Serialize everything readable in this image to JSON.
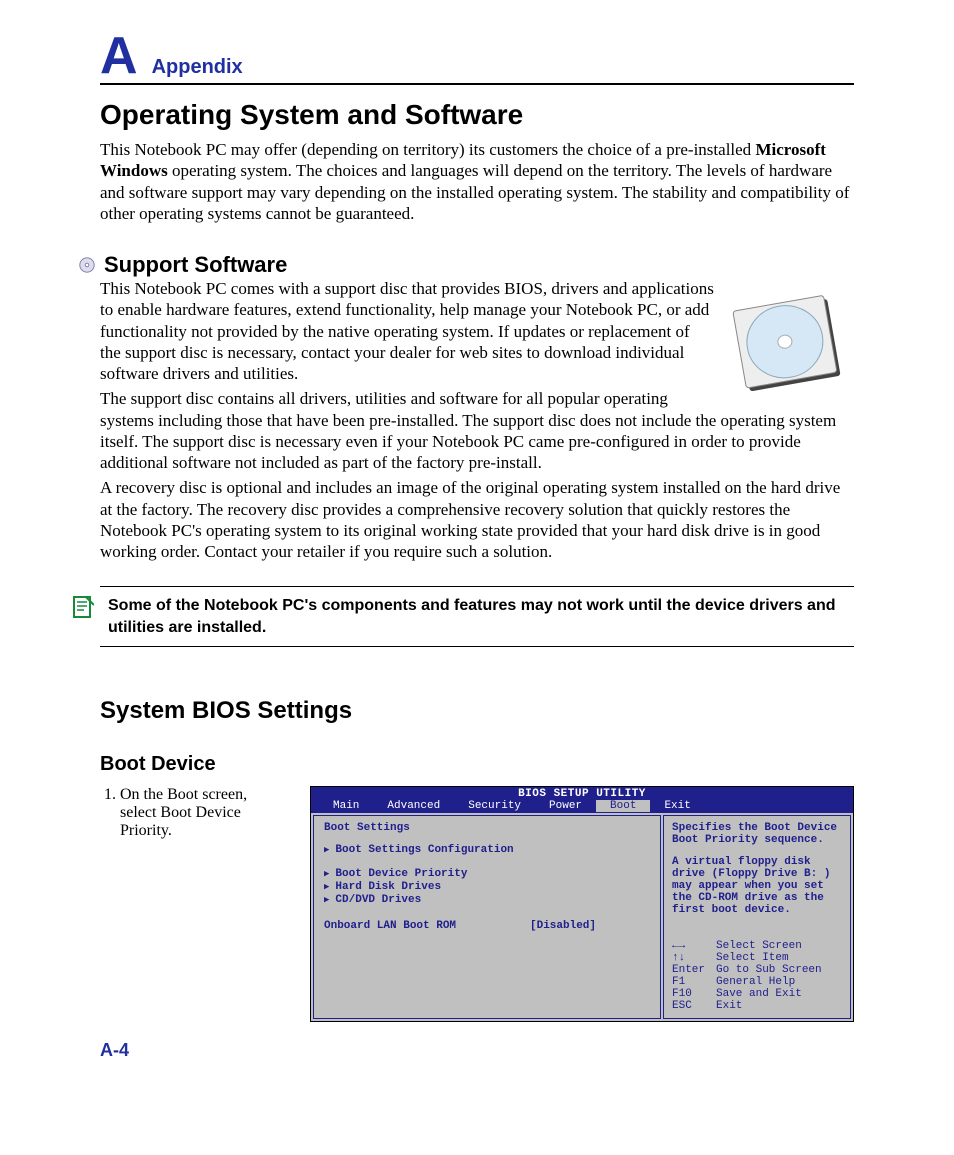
{
  "appendix": {
    "letter": "A",
    "word": "Appendix"
  },
  "title": "Operating System and Software",
  "intro_parts": {
    "p1": "This Notebook PC may offer (depending on territory) its customers the choice of a pre-installed ",
    "bold": "Microsoft Windows",
    "p2": " operating system. The choices and languages will depend on the territory. The levels of hardware and software support may vary depending on the installed operating system. The stability and compatibility of other operating systems cannot be guaranteed."
  },
  "support": {
    "heading": "Support Software",
    "p1": "This Notebook PC comes with a support disc that provides BIOS, drivers and applications to enable hardware features, extend functionality, help manage your Notebook PC, or add functionality not provided by the native operating system. If updates or replacement of the support disc is necessary, contact your dealer for web sites to download individual software drivers and utilities.",
    "p2": "The support disc contains all drivers, utilities and software for all popular operating systems including those that have been pre-installed. The support disc does not include the operating system itself. The support disc is necessary even if your Notebook PC came pre-configured in order to provide additional software not included as part of the factory pre-install.",
    "p3": "A recovery disc is optional and includes an image of the original operating system installed on the hard drive at the factory. The recovery disc provides a comprehensive recovery solution that quickly restores the Notebook PC's operating system to its original working state provided that your hard disk drive is in good working order. Contact your retailer if you require such a solution."
  },
  "note": "Some of the Notebook PC's components and features may not work until the device drivers and utilities are installed.",
  "bios_section": {
    "heading": "System BIOS Settings",
    "sub": "Boot Device",
    "instruction": "On the Boot screen, select Boot Device Priority."
  },
  "bios": {
    "title": "BIOS SETUP UTILITY",
    "tabs": [
      "Main",
      "Advanced",
      "Security",
      "Power",
      "Boot",
      "Exit"
    ],
    "active_tab": "Boot",
    "panel_title": "Boot Settings",
    "items": [
      "Boot Settings Configuration",
      "Boot Device Priority",
      "Hard Disk Drives",
      "CD/DVD Drives"
    ],
    "option": {
      "name": "Onboard LAN Boot ROM",
      "value": "[Disabled]"
    },
    "help": [
      "Specifies the Boot Device Boot Priority sequence.",
      "A virtual floppy disk drive (Floppy Drive B: ) may appear when you set the CD-ROM drive as the first boot device."
    ],
    "keys": [
      {
        "k": "←→",
        "d": "Select Screen"
      },
      {
        "k": "↑↓",
        "d": "Select Item"
      },
      {
        "k": "Enter",
        "d": "Go to Sub Screen"
      },
      {
        "k": "F1",
        "d": "General Help"
      },
      {
        "k": "F10",
        "d": "Save and Exit"
      },
      {
        "k": "ESC",
        "d": "Exit"
      }
    ]
  },
  "page_num": "A-4"
}
